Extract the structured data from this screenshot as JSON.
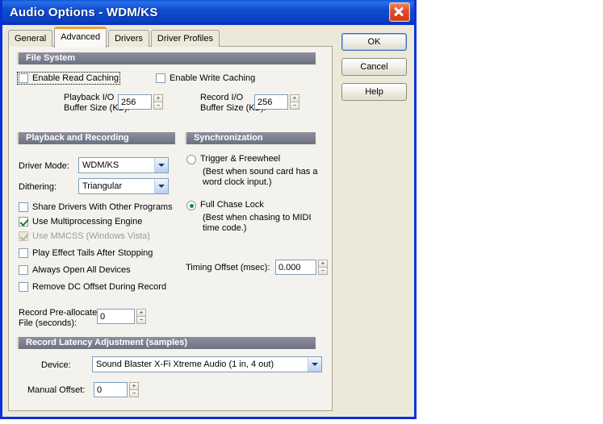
{
  "window": {
    "title": "Audio Options - WDM/KS",
    "close_icon": "close-icon"
  },
  "tabs": [
    {
      "label": "General",
      "active": false
    },
    {
      "label": "Advanced",
      "active": true
    },
    {
      "label": "Drivers",
      "active": false
    },
    {
      "label": "Driver Profiles",
      "active": false
    }
  ],
  "buttons": {
    "ok": "OK",
    "cancel": "Cancel",
    "help": "Help"
  },
  "file_system": {
    "header": "File System",
    "enable_read_caching": {
      "label": "Enable Read Caching",
      "checked": false
    },
    "enable_write_caching": {
      "label": "Enable Write Caching",
      "checked": false
    },
    "playback_buffer": {
      "label_line1": "Playback I/O",
      "label_line2": "Buffer Size (KB):",
      "value": "256"
    },
    "record_buffer": {
      "label_line1": "Record I/O",
      "label_line2": "Buffer Size (KB):",
      "value": "256"
    }
  },
  "playback_recording": {
    "header": "Playback and Recording",
    "driver_mode": {
      "label": "Driver Mode:",
      "value": "WDM/KS"
    },
    "dithering": {
      "label": "Dithering:",
      "value": "Triangular"
    },
    "checks": [
      {
        "label": "Share Drivers With Other Programs",
        "checked": false,
        "disabled": false
      },
      {
        "label": "Use Multiprocessing Engine",
        "checked": true,
        "disabled": false
      },
      {
        "label": "Use MMCSS (Windows Vista)",
        "checked": true,
        "disabled": true
      },
      {
        "label": "Play Effect Tails After Stopping",
        "checked": false,
        "disabled": false
      },
      {
        "label": "Always Open All Devices",
        "checked": false,
        "disabled": false
      },
      {
        "label": "Remove DC Offset During Record",
        "checked": false,
        "disabled": false
      }
    ],
    "prealloc": {
      "label_line1": "Record Pre-allocate",
      "label_line2": "File (seconds):",
      "value": "0"
    }
  },
  "synchronization": {
    "header": "Synchronization",
    "trigger": {
      "label": "Trigger & Freewheel",
      "hint_line1": "(Best when sound card has a",
      "hint_line2": "word clock input.)",
      "selected": false
    },
    "full_chase": {
      "label": "Full Chase Lock",
      "hint_line1": "(Best when chasing to MIDI",
      "hint_line2": "time code.)",
      "selected": true
    },
    "timing_offset": {
      "label": "Timing Offset (msec):",
      "value": "0.000"
    }
  },
  "record_latency": {
    "header": "Record Latency Adjustment (samples)",
    "device": {
      "label": "Device:",
      "value": "Sound Blaster X-Fi Xtreme Audio (1 in, 4 out)"
    },
    "manual_offset": {
      "label": "Manual Offset:",
      "value": "0"
    }
  }
}
